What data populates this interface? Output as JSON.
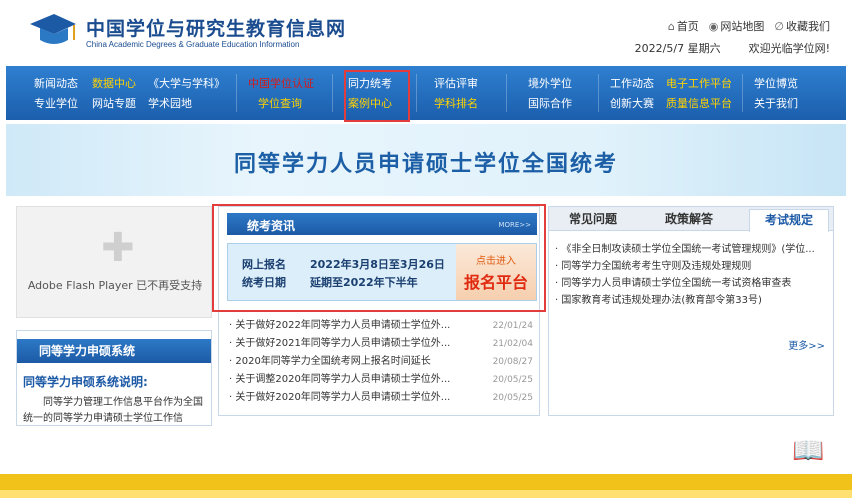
{
  "header": {
    "title": "中国学位与研究生教育信息网",
    "subtitle": "China Academic Degrees & Graduate Education Information",
    "links": [
      "首页",
      "网站地图",
      "收藏我们"
    ],
    "date": "2022/5/7 星期六",
    "welcome": "欢迎光临学位网!"
  },
  "nav": {
    "c1": [
      "新闻动态",
      "专业学位"
    ],
    "c2": [
      "数据中心",
      "网站专题"
    ],
    "c3": [
      "《大学与学科》",
      "学术园地"
    ],
    "c4": [
      "中国学位认证",
      "学位查询"
    ],
    "c5": [
      "同力统考",
      "案例中心"
    ],
    "c6": [
      "评估评审",
      "学科排名"
    ],
    "c7": [
      "境外学位",
      "国际合作"
    ],
    "c8": [
      "工作动态",
      "创新大赛"
    ],
    "c9": [
      "电子工作平台",
      "质量信息平台"
    ],
    "c10": [
      "学位博览",
      "关于我们"
    ]
  },
  "banner": {
    "title": "同等学力人员申请硕士学位全国统考"
  },
  "flash": {
    "text": "Adobe Flash Player 已不再受支持"
  },
  "system": {
    "title": "同等学力申硕系统",
    "subtitle": "同等学力申硕系统说明:",
    "desc": "同等学力管理工作信息平台作为全国统一的同等学力申请硕士学位工作信"
  },
  "news": {
    "title": "统考资讯",
    "more": "MORE>>",
    "reg_label": [
      "网上报名",
      "统考日期"
    ],
    "reg_dates": [
      "2022年3月8日至3月26日",
      "延期至2022年下半年"
    ],
    "reg_btn_small": "点击进入",
    "reg_btn_big": "报名平台",
    "items": [
      {
        "title": "· 关于做好2022年同等学力人员申请硕士学位外...",
        "date": "22/01/24"
      },
      {
        "title": "· 关于做好2021年同等学力人员申请硕士学位外...",
        "date": "21/02/04"
      },
      {
        "title": "· 2020年同等学力全国统考网上报名时间延长",
        "date": "20/08/27"
      },
      {
        "title": "· 关于调整2020年同等学力人员申请硕士学位外...",
        "date": "20/05/25"
      },
      {
        "title": "· 关于做好2020年同等学力人员申请硕士学位外...",
        "date": "20/05/25"
      }
    ]
  },
  "tabs": {
    "labels": [
      "常见问题",
      "政策解答",
      "考试规定"
    ],
    "rules": [
      "· 《非全日制攻读硕士学位全国统一考试管理规则》(学位...",
      "· 同等学力全国统考考生守则及违规处理规则",
      "· 同等学力人员申请硕士学位全国统一考试资格审查表",
      "· 国家教育考试违规处理办法(教育部令第33号)"
    ],
    "more": "更多>>"
  },
  "colors": {
    "brand_blue": "#1d5aa6",
    "highlight_red": "#e23c3c",
    "footer_yellow": "#f1c21a"
  }
}
